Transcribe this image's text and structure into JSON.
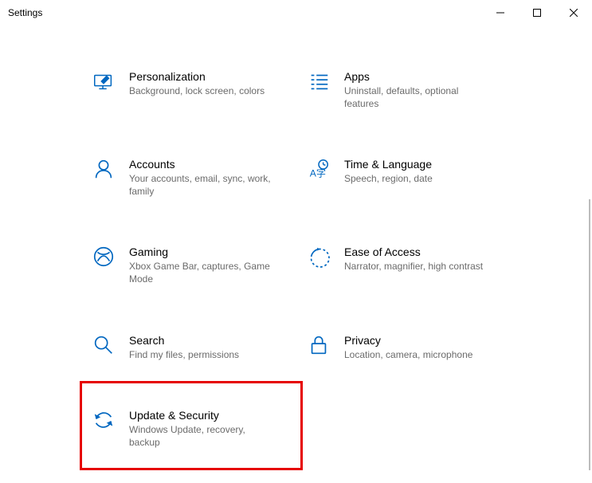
{
  "window": {
    "title": "Settings"
  },
  "categories": [
    {
      "title": "Personalization",
      "desc": "Background, lock screen, colors"
    },
    {
      "title": "Apps",
      "desc": "Uninstall, defaults, optional features"
    },
    {
      "title": "Accounts",
      "desc": "Your accounts, email, sync, work, family"
    },
    {
      "title": "Time & Language",
      "desc": "Speech, region, date"
    },
    {
      "title": "Gaming",
      "desc": "Xbox Game Bar, captures, Game Mode"
    },
    {
      "title": "Ease of Access",
      "desc": "Narrator, magnifier, high contrast"
    },
    {
      "title": "Search",
      "desc": "Find my files, permissions"
    },
    {
      "title": "Privacy",
      "desc": "Location, camera, microphone"
    },
    {
      "title": "Update & Security",
      "desc": "Windows Update, recovery, backup"
    }
  ]
}
